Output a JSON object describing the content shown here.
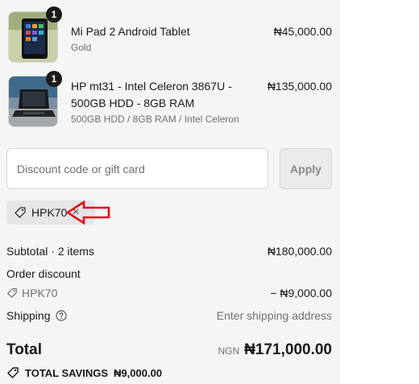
{
  "items": [
    {
      "qty": "1",
      "title": "Mi Pad 2 Android Tablet",
      "subtitle": "Gold",
      "price": "₦45,000.00"
    },
    {
      "qty": "1",
      "title_line1": "HP mt31 - Intel Celeron 3867U -",
      "title_line2": "500GB HDD - 8GB RAM",
      "subtitle": "500GB HDD / 8GB RAM / Intel Celeron",
      "price": "₦135,000.00"
    }
  ],
  "discount": {
    "placeholder": "Discount code or gift card",
    "apply_label": "Apply",
    "applied_code": "HPK70",
    "close_glyph": "×"
  },
  "summary": {
    "subtotal_label": "Subtotal · 2 items",
    "subtotal_value": "₦180,000.00",
    "order_discount_label": "Order discount",
    "discount_code": "HPK70",
    "discount_value": "− ₦9,000.00",
    "shipping_label": "Shipping",
    "shipping_value": "Enter shipping address",
    "total_label": "Total",
    "total_currency": "NGN",
    "total_value": "₦171,000.00",
    "savings_label": "TOTAL SAVINGS",
    "savings_value": "₦9,000.00"
  },
  "icons": {
    "tag": "tag-icon",
    "help": "help-circle-icon",
    "annotation": "red-arrow-annotation"
  },
  "colors": {
    "panel_bg": "#f5f5f5",
    "annotation_red": "#e0101e",
    "badge_bg": "#1a1a1a"
  }
}
